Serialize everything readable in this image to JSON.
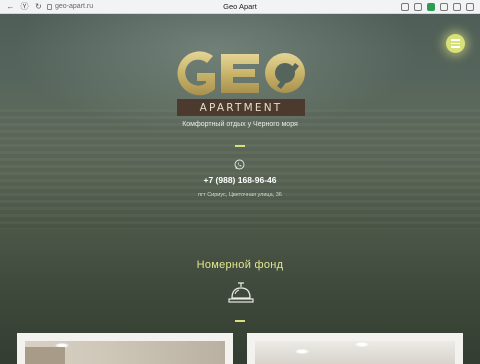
{
  "browser": {
    "url": "geo-apart.ru",
    "title": "Geo Apart"
  },
  "logo": {
    "word": "GEO",
    "sub": "APARTMENT"
  },
  "hero": {
    "tagline": "Комфортный отдых у Черного моря",
    "phone": "+7 (988) 168-96-46",
    "address": "пгт Сириус, Цветочная улица, 36"
  },
  "rooms": {
    "title": "Номерной фонд"
  },
  "colors": {
    "accent": "#d8e07a",
    "logo_gold": "#c9b46a",
    "apartment_bar": "#4b3a2d"
  },
  "icons": {
    "menu": "hamburger-icon",
    "phone": "whatsapp-icon",
    "rooms": "reception-bell-icon"
  }
}
